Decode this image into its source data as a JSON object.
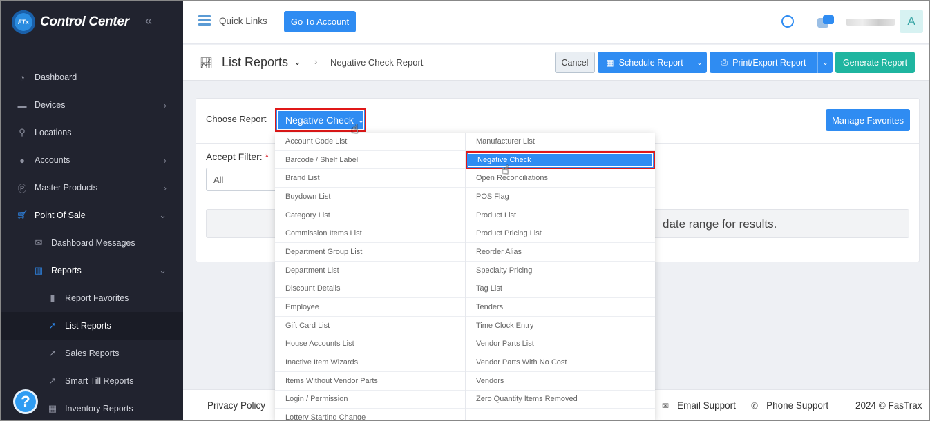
{
  "brand": {
    "logo_text": "FTx",
    "name": "Control Center"
  },
  "sidebar": {
    "items": [
      {
        "label": "Dashboard",
        "icon": "gauge-icon"
      },
      {
        "label": "Devices",
        "icon": "devices-icon"
      },
      {
        "label": "Locations",
        "icon": "pin-icon"
      },
      {
        "label": "Accounts",
        "icon": "users-icon"
      },
      {
        "label": "Master Products",
        "icon": "product-icon"
      },
      {
        "label": "Point Of Sale",
        "icon": "cart-icon"
      },
      {
        "label": "Dashboard Messages",
        "icon": "message-icon"
      },
      {
        "label": "Reports",
        "icon": "bar-chart-icon"
      },
      {
        "label": "Report Favorites",
        "icon": "bookmark-icon"
      },
      {
        "label": "List Reports",
        "icon": "line-chart-icon"
      },
      {
        "label": "Sales Reports",
        "icon": "line-chart-icon"
      },
      {
        "label": "Smart Till Reports",
        "icon": "line-chart-icon"
      },
      {
        "label": "Inventory Reports",
        "icon": "inventory-icon"
      }
    ]
  },
  "help": {
    "label": "?"
  },
  "topbar": {
    "quick_links": "Quick Links",
    "go_to_account": "Go To Account",
    "avatar_letter": "A"
  },
  "header": {
    "title": "List Reports",
    "breadcrumb": "Negative Check Report",
    "cancel": "Cancel",
    "schedule": "Schedule Report",
    "print_export": "Print/Export Report",
    "generate": "Generate Report"
  },
  "form": {
    "choose_report_label": "Choose Report",
    "selected_report": "Negative Check",
    "manage_favorites": "Manage Favorites",
    "accept_filter_label": "Accept Filter:",
    "required_mark": "*",
    "accept_filter_value": "All",
    "message": "date range for results."
  },
  "dropdown": {
    "left": [
      "Account Code List",
      "Barcode / Shelf Label",
      "Brand List",
      "Buydown List",
      "Category List",
      "Commission Items List",
      "Department Group List",
      "Department List",
      "Discount Details",
      "Employee",
      "Gift Card List",
      "House Accounts List",
      "Inactive Item Wizards",
      "Items Without Vendor Parts",
      "Login / Permission",
      "Lottery Starting Change"
    ],
    "right": [
      "Manufacturer List",
      "Negative Check",
      "Open Reconciliations",
      "POS Flag",
      "Product List",
      "Product Pricing List",
      "Reorder Alias",
      "Specialty Pricing",
      "Tag List",
      "Tenders",
      "Time Clock Entry",
      "Vendor Parts List",
      "Vendor Parts With No Cost",
      "Vendors",
      "Zero Quantity Items Removed",
      ""
    ],
    "selected": "Negative Check"
  },
  "footer": {
    "privacy": "Privacy Policy",
    "email": "Email Support",
    "phone": "Phone Support",
    "copyright": "2024 © FasTrax"
  },
  "colors": {
    "primary": "#2f8cf2",
    "success": "#1fb5a0",
    "sidebar": "#21232f",
    "highlight_border": "#e01818"
  }
}
